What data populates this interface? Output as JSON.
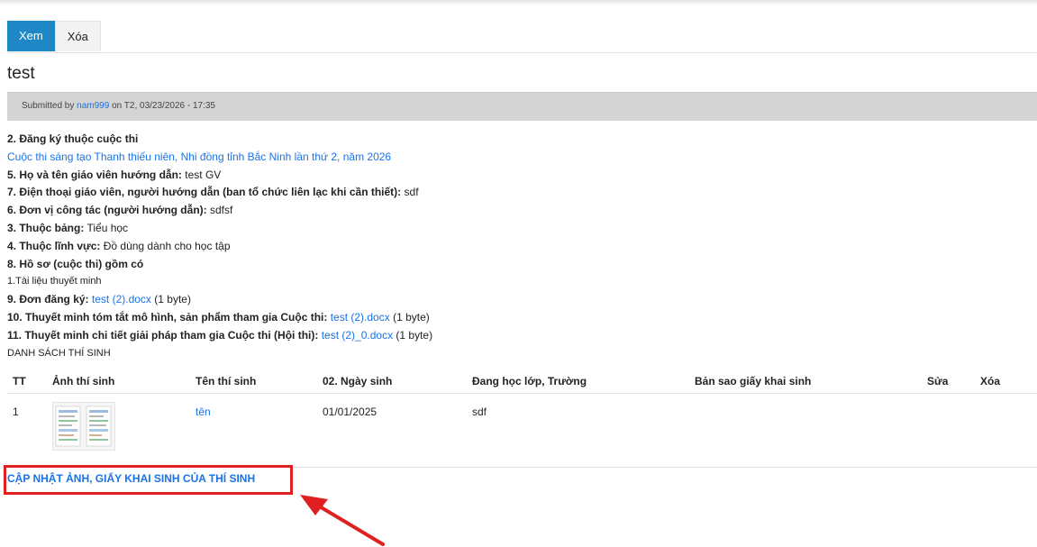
{
  "tabs": [
    {
      "label": "Xem"
    },
    {
      "label": "Xóa"
    }
  ],
  "title": "test",
  "submitted": {
    "prefix": "Submitted by",
    "user": "nam999",
    "suffix": "on T2, 03/23/2026 - 17:35"
  },
  "fields": {
    "f2_label": "2. Đăng ký thuộc cuộc thi",
    "f2_value": "Cuộc thi sáng tạo Thanh thiếu niên, Nhi đồng tỉnh Bắc Ninh lần thứ 2, năm 2026",
    "f5_label": "5. Họ và tên giáo viên hướng dẫn:",
    "f5_value": "test GV",
    "f7_label": "7. Điện thoại giáo viên, người hướng dẫn (ban tổ chức liên lạc khi cần thiết):",
    "f7_value": "sdf",
    "f6_label": "6. Đơn vị công tác (người hướng dẫn):",
    "f6_value": "sdfsf",
    "f3_label": "3. Thuộc bảng:",
    "f3_value": "Tiểu học",
    "f4_label": "4. Thuộc lĩnh vực:",
    "f4_value": "Đồ dùng dành cho học tập",
    "f8_label": "8. Hồ sơ (cuộc thi) gồm có",
    "f8_value": "1.Tài liệu thuyết minh",
    "f9_label": "9. Đơn đăng ký:",
    "f9_file": "test (2).docx",
    "f9_size": "(1 byte)",
    "f10_label": "10. Thuyết minh tóm tắt mô hình, sản phẩm tham gia Cuộc thi:",
    "f10_file": "test (2).docx",
    "f10_size": "(1 byte)",
    "f11_label": "11. Thuyết minh chi tiết giải pháp tham gia Cuộc thi (Hội thi):",
    "f11_file": "test (2)_0.docx",
    "f11_size": "(1 byte)",
    "list_heading": "DANH SÁCH THÍ SINH"
  },
  "table": {
    "headers": [
      "TT",
      "Ảnh thí sinh",
      "Tên thí sinh",
      "02. Ngày sinh",
      "Đang học lớp, Trường",
      "Bản sao giấy khai sinh",
      "Sửa",
      "Xóa"
    ],
    "rows": [
      {
        "tt": "1",
        "name": "tên",
        "dob": "01/01/2025",
        "school": "sdf",
        "birth_cert": "",
        "edit": "",
        "delete": ""
      }
    ]
  },
  "update_link": "CẬP NHẬT ẢNH, GIẤY KHAI SINH CỦA THÍ SINH",
  "colors": {
    "tab_active": "#1e88c7",
    "link": "#1a73e8",
    "highlight": "#e02020",
    "submitted_bg": "#d4d4d4"
  }
}
